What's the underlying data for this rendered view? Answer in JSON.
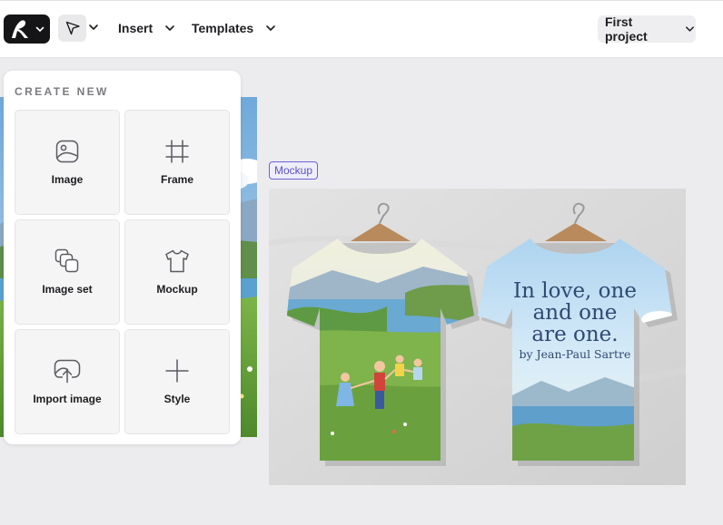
{
  "toolbar": {
    "insert_label": "Insert",
    "templates_label": "Templates",
    "project_label": "First project"
  },
  "panel": {
    "title": "CREATE NEW",
    "items": [
      {
        "label": "Image",
        "icon": "image-icon"
      },
      {
        "label": "Frame",
        "icon": "frame-icon"
      },
      {
        "label": "Image set",
        "icon": "image-set-icon"
      },
      {
        "label": "Mockup",
        "icon": "tshirt-icon"
      },
      {
        "label": "Import image",
        "icon": "cloud-upload-icon"
      },
      {
        "label": "Style",
        "icon": "plus-icon"
      }
    ]
  },
  "canvas": {
    "badge_label": "Mockup",
    "shirt_text": {
      "line1": "In love, one",
      "line2": "and one",
      "line3": "are one.",
      "author": "by Jean-Paul Sartre"
    }
  },
  "colors": {
    "accent": "#6b63d6",
    "logo_bg": "#151517"
  }
}
